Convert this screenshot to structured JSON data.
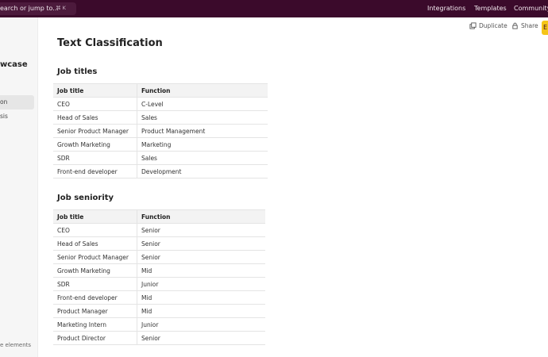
{
  "topbar": {
    "search_text": "earch or jump to...",
    "search_shortcut": "⌘ K",
    "nav": [
      "Integrations",
      "Templates",
      "Community"
    ]
  },
  "sidebar": {
    "title": "wcase",
    "items": [
      {
        "label": "on",
        "active": true
      },
      {
        "label": "sis",
        "active": false
      }
    ],
    "footer": "e elements"
  },
  "actions": {
    "duplicate": "Duplicate",
    "share": "Share",
    "edit": "E"
  },
  "page": {
    "title": "Text Classification"
  },
  "tables": [
    {
      "title": "Job titles",
      "headers": [
        "Job title",
        "Function"
      ],
      "rows": [
        [
          "CEO",
          "C-Level"
        ],
        [
          "Head of Sales",
          "Sales"
        ],
        [
          "Senior Product Manager",
          "Product Management"
        ],
        [
          "Growth Marketing",
          "Marketing"
        ],
        [
          "SDR",
          "Sales"
        ],
        [
          "Front-end developer",
          "Development"
        ]
      ]
    },
    {
      "title": "Job seniority",
      "headers": [
        "Job title",
        "Function"
      ],
      "rows": [
        [
          "CEO",
          "Senior"
        ],
        [
          "Head of Sales",
          "Senior"
        ],
        [
          "Senior Product Manager",
          "Senior"
        ],
        [
          "Growth Marketing",
          "Mid"
        ],
        [
          "SDR",
          "Junior"
        ],
        [
          "Front-end developer",
          "Mid"
        ],
        [
          "Product Manager",
          "Mid"
        ],
        [
          "Marketing Intern",
          "Junior"
        ],
        [
          "Product Director",
          "Senior"
        ]
      ]
    }
  ]
}
